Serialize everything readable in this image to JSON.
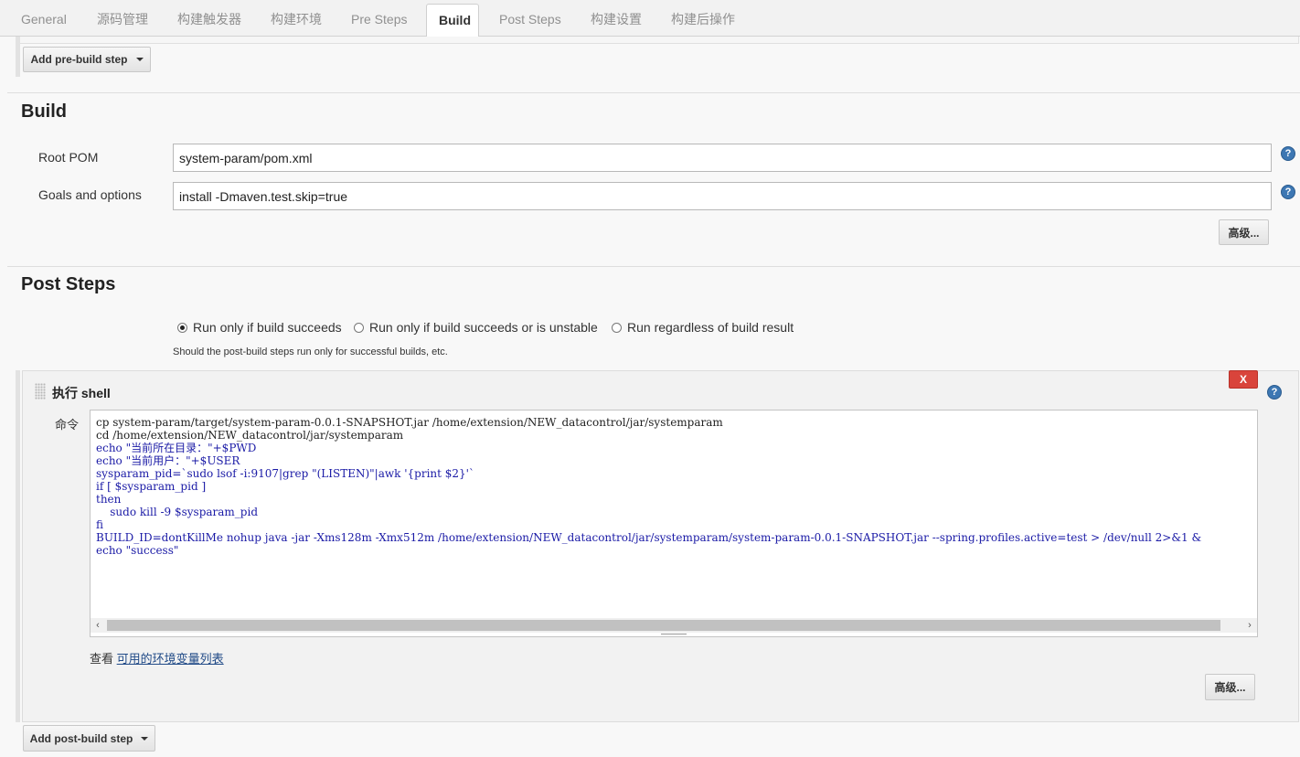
{
  "tabs": [
    "General",
    "源码管理",
    "构建触发器",
    "构建环境",
    "Pre Steps",
    "Build",
    "Post Steps",
    "构建设置",
    "构建后操作"
  ],
  "active_tab": "Build",
  "pre_steps": {
    "add_button": "Add pre-build step"
  },
  "build": {
    "title": "Build",
    "root_pom_label": "Root POM",
    "root_pom_value": "system-param/pom.xml",
    "goals_label": "Goals and options",
    "goals_value": "install -Dmaven.test.skip=true",
    "advanced_button": "高级..."
  },
  "post_steps": {
    "title": "Post Steps",
    "options": [
      "Run only if build succeeds",
      "Run only if build succeeds or is unstable",
      "Run regardless of build result"
    ],
    "selected_option": "Run only if build succeeds",
    "description": "Should the post-build steps run only for successful builds, etc.",
    "shell": {
      "title": "执行 shell",
      "delete_label": "X",
      "command_label": "命令",
      "command_lines": [
        "cp system-param/target/system-param-0.0.1-SNAPSHOT.jar /home/extension/NEW_datacontrol/jar/systemparam",
        "cd /home/extension/NEW_datacontrol/jar/systemparam",
        "echo \"当前所在目录：\"+$PWD",
        "echo \"当前用户：\"+$USER",
        "sysparam_pid=`sudo lsof -i:9107|grep \"(LISTEN)\"|awk '{print $2}'`",
        "if [ $sysparam_pid ]",
        "then",
        "    sudo kill -9 $sysparam_pid",
        "fi",
        "BUILD_ID=dontKillMe nohup java -jar -Xms128m -Xmx512m /home/extension/NEW_datacontrol/jar/systemparam/system-param-0.0.1-SNAPSHOT.jar --spring.profiles.active=test > /dev/null 2>&1 &",
        "echo \"success\""
      ],
      "env_prefix": "查看",
      "env_link": "可用的环境变量列表",
      "advanced_button": "高级..."
    },
    "add_button": "Add post-build step"
  },
  "icons": {
    "help": "help-icon",
    "caret": "caret-down-icon",
    "grip": "drag-handle-icon"
  }
}
